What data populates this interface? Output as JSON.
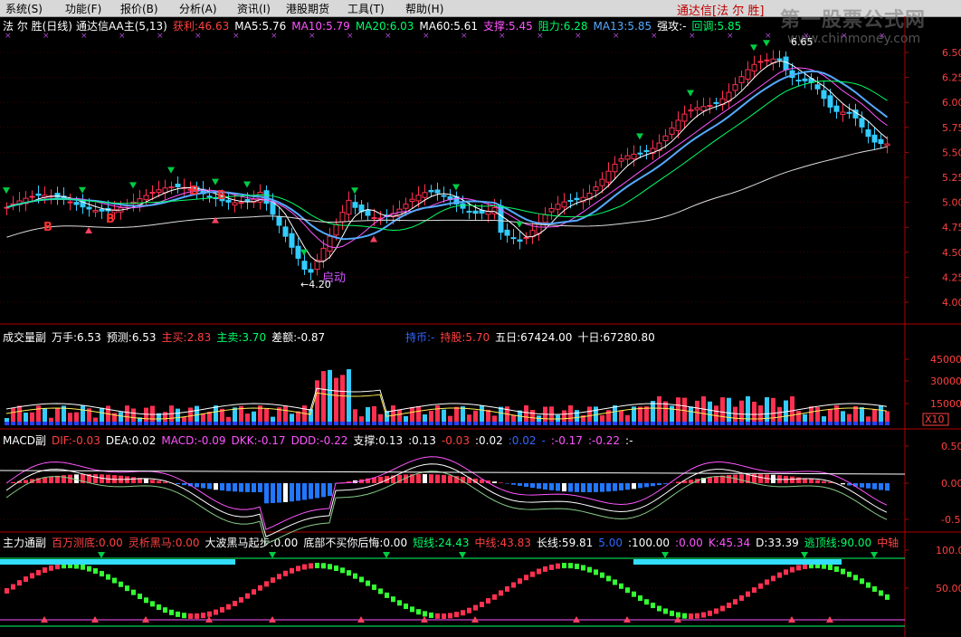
{
  "menu": {
    "items": [
      "系统(S)",
      "功能(F)",
      "报价(B)",
      "分析(A)",
      "资讯(I)",
      "港股期货",
      "工具(T)",
      "帮助(H)"
    ],
    "brand": "通达信[法 尔 胜]",
    "watermark": "第一股票公式网",
    "watermark_sub": "www.chinmoney.com"
  },
  "main_chart": {
    "title": "法 尔 胜(日线)",
    "indicator": "通达信AA主(5,13)",
    "legend": [
      {
        "text": "获利:46.63",
        "color": "#ff4040"
      },
      {
        "text": "MA5:5.76",
        "color": "#ffffff"
      },
      {
        "text": "MA10:5.79",
        "color": "#ff55ff"
      },
      {
        "text": "MA20:6.03",
        "color": "#00ff66"
      },
      {
        "text": "MA60:5.61",
        "color": "#ffffff"
      },
      {
        "text": "支撑:5.45",
        "color": "#ff55ff"
      },
      {
        "text": "阻力:6.28",
        "color": "#00ff66"
      },
      {
        "text": "MA13:5.85",
        "color": "#55aaff"
      },
      {
        "text": "强攻:-",
        "color": "#ffffff"
      },
      {
        "text": "回调:5.85",
        "color": "#00ff66"
      }
    ],
    "y_ticks": [
      "6.50",
      "6.25",
      "6.00",
      "5.75",
      "5.50",
      "5.25",
      "5.00",
      "4.75",
      "4.50",
      "4.25",
      "4.00"
    ],
    "buy_labels": [
      "B",
      "B",
      "B",
      "B"
    ],
    "startup_label": "启动",
    "low_label": "←4.20",
    "high_label": "6.65"
  },
  "volume_chart": {
    "title": "成交量副",
    "legend": [
      {
        "text": "万手:6.53",
        "color": "#ffffff"
      },
      {
        "text": "预测:6.53",
        "color": "#ffffff"
      },
      {
        "text": "主买:2.83",
        "color": "#ff4040"
      },
      {
        "text": "主卖:3.70",
        "color": "#00ff66"
      },
      {
        "text": "差额:-0.87",
        "color": "#ffffff"
      }
    ],
    "legend2": [
      {
        "text": "持币:-",
        "color": "#3366ff"
      },
      {
        "text": "持股:5.70",
        "color": "#ff4040"
      },
      {
        "text": "五日:67424.00",
        "color": "#ffffff"
      },
      {
        "text": "十日:67280.80",
        "color": "#ffffff"
      }
    ],
    "y_ticks": [
      "45000",
      "30000",
      "15000"
    ],
    "unit": "X10"
  },
  "macd_chart": {
    "title": "MACD副",
    "legend": [
      {
        "text": "DIF:-0.03",
        "color": "#ff4040"
      },
      {
        "text": "DEA:0.02",
        "color": "#ffffff"
      },
      {
        "text": "MACD:-0.09",
        "color": "#ff55ff"
      },
      {
        "text": "DKK:-0.17",
        "color": "#ff55ff"
      },
      {
        "text": "DDD:-0.22",
        "color": "#ff55ff"
      },
      {
        "text": "支撑:0.13",
        "color": "#ffffff"
      },
      {
        "text": ":0.13",
        "color": "#ffffff"
      },
      {
        "text": "-0.03",
        "color": "#ff4040"
      },
      {
        "text": ":0.02",
        "color": "#ffffff"
      },
      {
        "text": ":0.02",
        "color": "#3366ff"
      },
      {
        "text": "-",
        "color": "#3366ff"
      },
      {
        "text": ":-0.17",
        "color": "#ff55ff"
      },
      {
        "text": ":-0.22",
        "color": "#ff55ff"
      },
      {
        "text": ":-",
        "color": "#ffffff"
      }
    ],
    "y_ticks": [
      "0.50",
      "0.00",
      "-0.50"
    ]
  },
  "main_force_chart": {
    "title": "主力通副",
    "legend": [
      {
        "text": "百万测底:0.00",
        "color": "#ff4040"
      },
      {
        "text": "灵析黑马:0.00",
        "color": "#ff4040"
      },
      {
        "text": "大波黑马起步:0.00",
        "color": "#ffffff"
      },
      {
        "text": "底部不买你后悔:0.00",
        "color": "#ffffff"
      },
      {
        "text": "短线:24.43",
        "color": "#00ff66"
      },
      {
        "text": "中线:43.83",
        "color": "#ff4040"
      },
      {
        "text": "长线:59.81",
        "color": "#ffffff"
      },
      {
        "text": "5.00",
        "color": "#3366ff"
      },
      {
        "text": ":100.00",
        "color": "#ffffff"
      },
      {
        "text": ":0.00",
        "color": "#ff55ff"
      },
      {
        "text": "K:45.34",
        "color": "#ff55ff"
      },
      {
        "text": "D:33.39",
        "color": "#ffffff"
      },
      {
        "text": "逃顶线:90.00",
        "color": "#00ff66"
      },
      {
        "text": "中轴",
        "color": "#ff4040"
      }
    ],
    "y_ticks": [
      "100.00",
      "50.00"
    ]
  },
  "colors": {
    "up": "#ff3050",
    "down": "#33ccff",
    "divider": "#b00000",
    "axis_text": "#ff4040"
  }
}
